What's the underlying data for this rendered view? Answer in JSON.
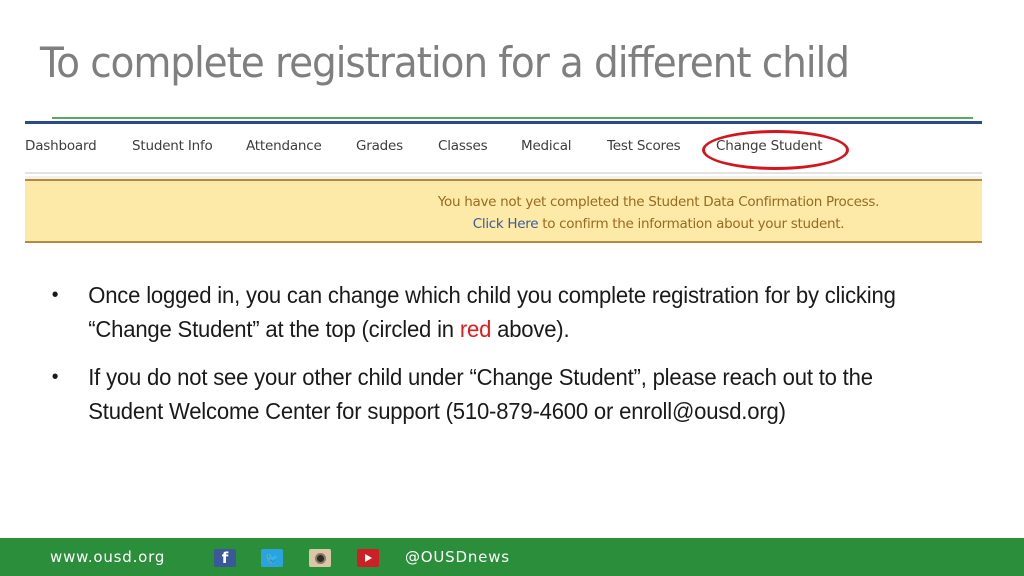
{
  "slide": {
    "title": "To complete registration for a different child"
  },
  "screenshot": {
    "nav_items": [
      {
        "label": "Dashboard"
      },
      {
        "label": "Student Info"
      },
      {
        "label": "Attendance"
      },
      {
        "label": "Grades"
      },
      {
        "label": "Classes"
      },
      {
        "label": "Medical"
      },
      {
        "label": "Test Scores"
      },
      {
        "label": "Change Student"
      }
    ],
    "highlighted_item": "Change Student",
    "highlight_color": "#d3161d",
    "banner": {
      "line1": "You have not yet completed the Student Data Confirmation Process.",
      "link_text": "Click Here",
      "line2_rest": " to confirm the information about your student."
    }
  },
  "bullets": [
    {
      "text_before": "Once logged in, you can change which child you complete registration for by clicking “Change Student” at the top (circled in ",
      "highlight": "red",
      "text_after": " above)."
    },
    {
      "text": "If you do not see your other child under “Change Student”, please reach out to the Student Welcome Center for support (510-879-4600 or enroll@ousd.org)"
    }
  ],
  "footer": {
    "url": "www.ousd.org",
    "social_icons": [
      "facebook-icon",
      "twitter-icon",
      "instagram-icon",
      "youtube-icon"
    ],
    "facebook_glyph": "f",
    "twitter_glyph": "❧",
    "handle": "@OUSDnews",
    "background_color": "#2b8e3b"
  }
}
